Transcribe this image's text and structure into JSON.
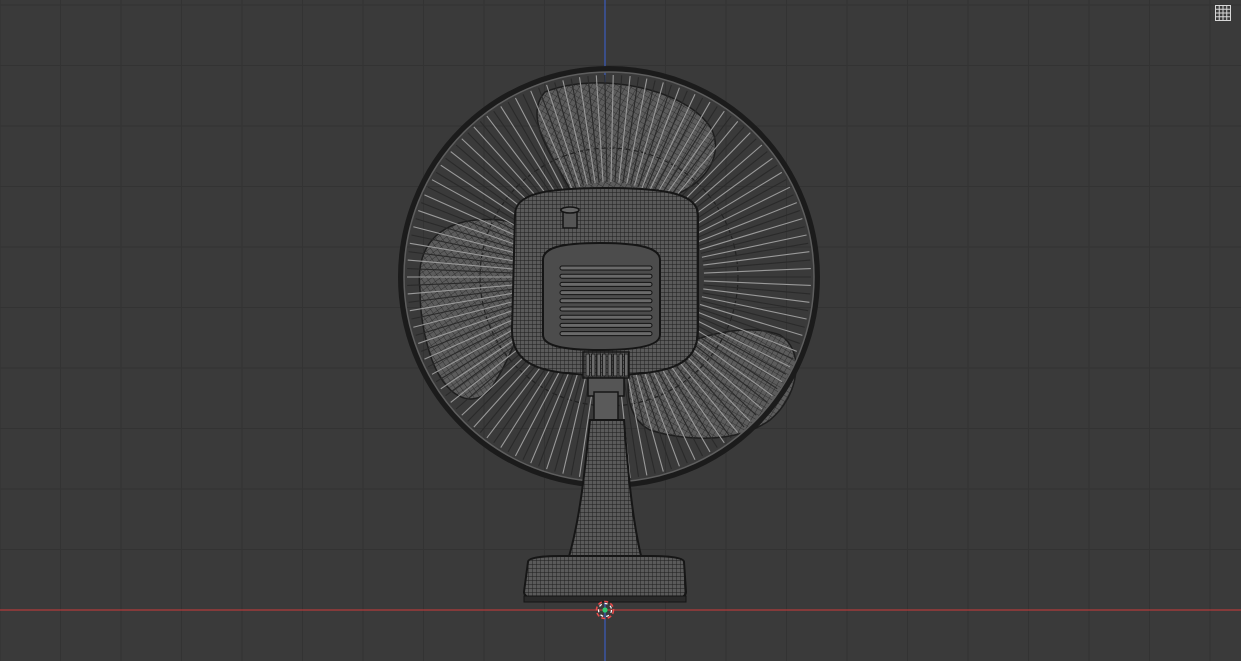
{
  "viewport": {
    "background": "#3a3a3a",
    "grid_minor_color": "#333333",
    "grid_major_color": "#2c2c2c",
    "axis_x_color": "#b23a3a",
    "axis_z_color": "#3a5bbd",
    "view": "front-orthographic",
    "shading": "wireframe"
  },
  "model": {
    "name": "desk fan",
    "wire_color": "#1a1a1a",
    "surface_color": "#575757"
  },
  "overlay": {
    "grid_toggle_icon": "grid-icon",
    "origin_icon": "object-origin-icon",
    "origin_outer_color": "#e84a4a",
    "origin_inner_color": "#2ecc71"
  }
}
